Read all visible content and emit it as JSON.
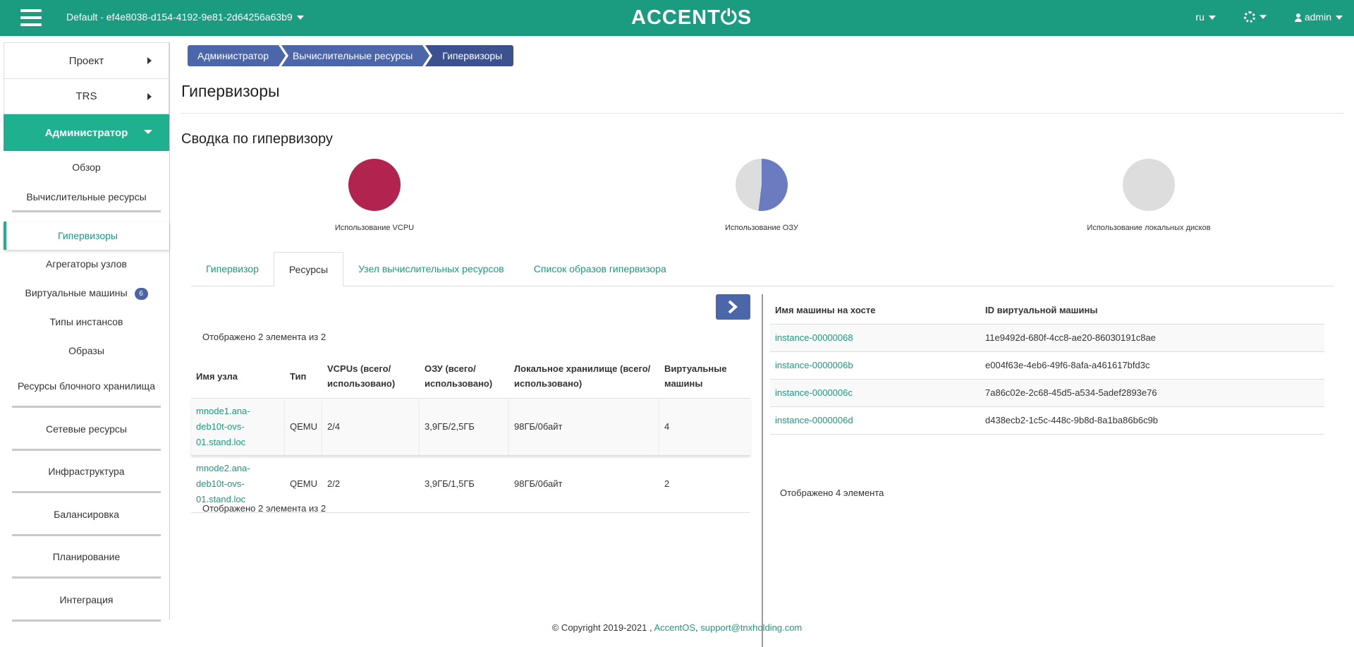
{
  "header": {
    "project": "Default - ef4e8038-d154-4192-9e81-2d64256a63b9",
    "logo": "ACCENT⏻S",
    "lang": "ru",
    "user": "admin",
    "colors": {
      "bar": "#1b9b80"
    }
  },
  "sidebar": {
    "project": "Проект",
    "trs": "TRS",
    "admin": "Администратор",
    "items": [
      "Обзор",
      "Вычислительные ресурсы",
      "Гипервизоры",
      "Агрегаторы узлов",
      "Виртуальные машины",
      "Типы инстансов",
      "Образы",
      "Ресурсы блочного хранилища",
      "Сетевые ресурсы",
      "Инфраструктура",
      "Балансировка",
      "Планирование",
      "Интеграция"
    ],
    "vm_badge": "6"
  },
  "breadcrumb": [
    "Администратор",
    "Вычислительные ресурсы",
    "Гипервизоры"
  ],
  "page": {
    "title": "Гипервизоры",
    "summary_title": "Сводка по гипервизору"
  },
  "charts": [
    {
      "label": "Использование VCPU",
      "used_fraction": 1.0,
      "color": "#b0244f"
    },
    {
      "label": "Использование ОЗУ",
      "used_fraction": 0.52,
      "color": "#6a7bbf"
    },
    {
      "label": "Использование локальных дисков",
      "used_fraction": 0.0,
      "color": "#dddddd"
    }
  ],
  "tabs": [
    "Гипервизор",
    "Ресурсы",
    "Узел вычислительных ресурсов",
    "Список образов гипервизора"
  ],
  "active_tab": "Ресурсы",
  "left_table": {
    "count": "Отображено 2 элемента из 2",
    "headers": [
      "Имя узла",
      "Тип",
      "VCPUs (всего/ использовано)",
      "ОЗУ (всего/ использовано)",
      "Локальное хранилище (всего/использовано)",
      "Виртуальные машины"
    ],
    "rows": [
      {
        "host": "mnode1.ana-deb10t-ovs-01.stand.loc",
        "type": "QEMU",
        "vcpu": "2/4",
        "ram": "3,9ГБ/2,5ГБ",
        "storage": "98ГБ/0байт",
        "vms": "4"
      },
      {
        "host": "mnode2.ana-deb10t-ovs-01.stand.loc",
        "type": "QEMU",
        "vcpu": "2/2",
        "ram": "3,9ГБ/1,5ГБ",
        "storage": "98ГБ/0байт",
        "vms": "2"
      }
    ]
  },
  "right_table": {
    "headers": [
      "Имя машины на хосте",
      "ID виртуальной машины"
    ],
    "rows": [
      {
        "name": "instance-00000068",
        "id": "11e9492d-680f-4cc8-ae20-86030191c8ae"
      },
      {
        "name": "instance-0000006b",
        "id": "e004f63e-4eb6-49f6-8afa-a461617bfd3c"
      },
      {
        "name": "instance-0000006c",
        "id": "7a86c02e-2c68-45d5-a534-5adef2893e76"
      },
      {
        "name": "instance-0000006d",
        "id": "d438ecb2-1c5c-448c-9b8d-8a1ba86b6c9b"
      }
    ],
    "count": "Отображено 4 элемента"
  },
  "footer": {
    "copyright": "© Copyright 2019-2021 ,",
    "brand": "AccentOS",
    "sep": ",",
    "email": "support@tnxholding.com"
  }
}
